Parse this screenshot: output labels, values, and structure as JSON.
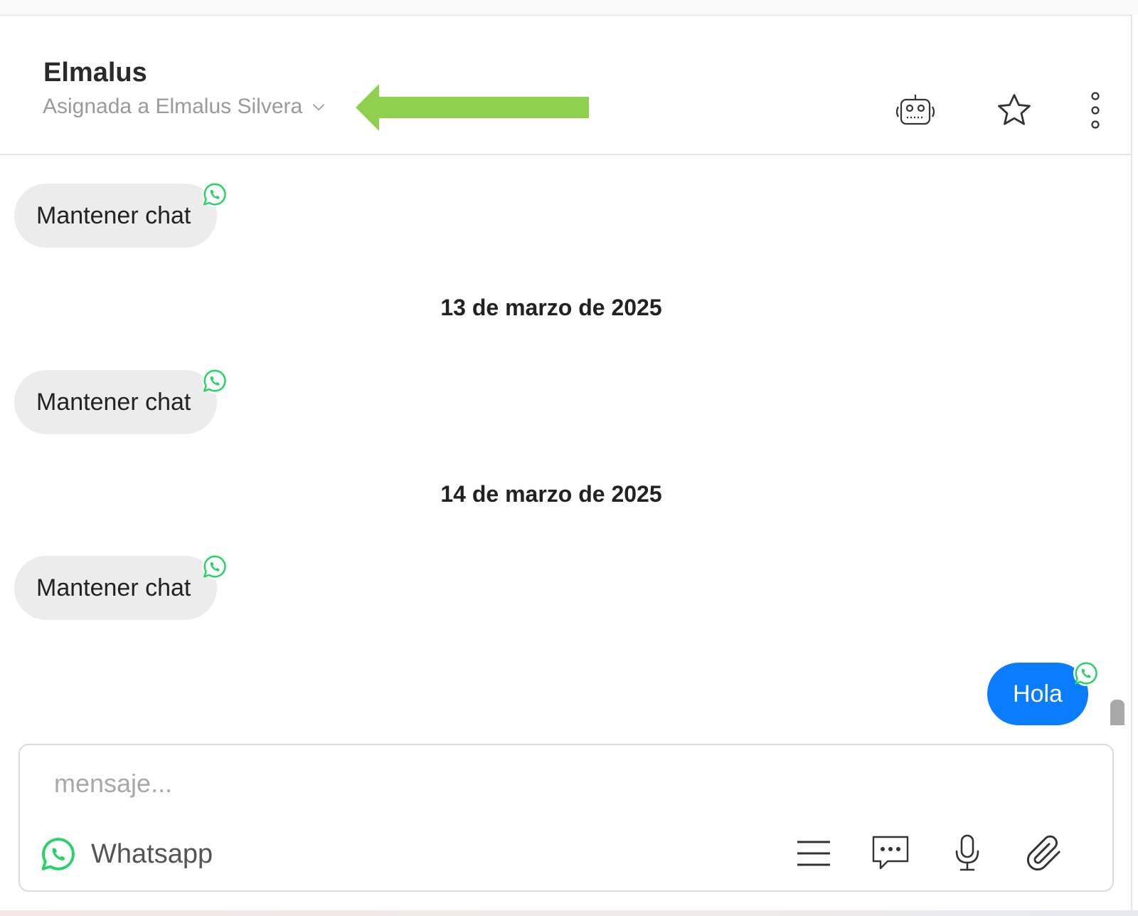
{
  "header": {
    "contact_name": "Elmalus",
    "assigned_label": "Asignada a Elmalus Silvera",
    "icons": [
      "robot-icon",
      "star-icon",
      "more-vertical-icon",
      "chevron-down-icon"
    ]
  },
  "messages": [
    {
      "direction": "incoming",
      "text": "Mantener chat",
      "channel": "whatsapp"
    },
    {
      "type": "date",
      "text": "13 de marzo de 2025"
    },
    {
      "direction": "incoming",
      "text": "Mantener chat",
      "channel": "whatsapp"
    },
    {
      "type": "date",
      "text": "14 de marzo de 2025"
    },
    {
      "direction": "incoming",
      "text": "Mantener chat",
      "channel": "whatsapp"
    },
    {
      "direction": "outgoing",
      "text": "Hola",
      "channel": "whatsapp"
    }
  ],
  "composer": {
    "placeholder": "mensaje...",
    "value": "",
    "channel_label": "Whatsapp",
    "tools": [
      "templates-menu-icon",
      "quick-replies-icon",
      "microphone-icon",
      "attachment-icon"
    ]
  },
  "colors": {
    "accent_blue": "#0a7cff",
    "whatsapp_green": "#25d366",
    "annotation_arrow": "#8fd14f",
    "incoming_bubble": "#ececec"
  }
}
